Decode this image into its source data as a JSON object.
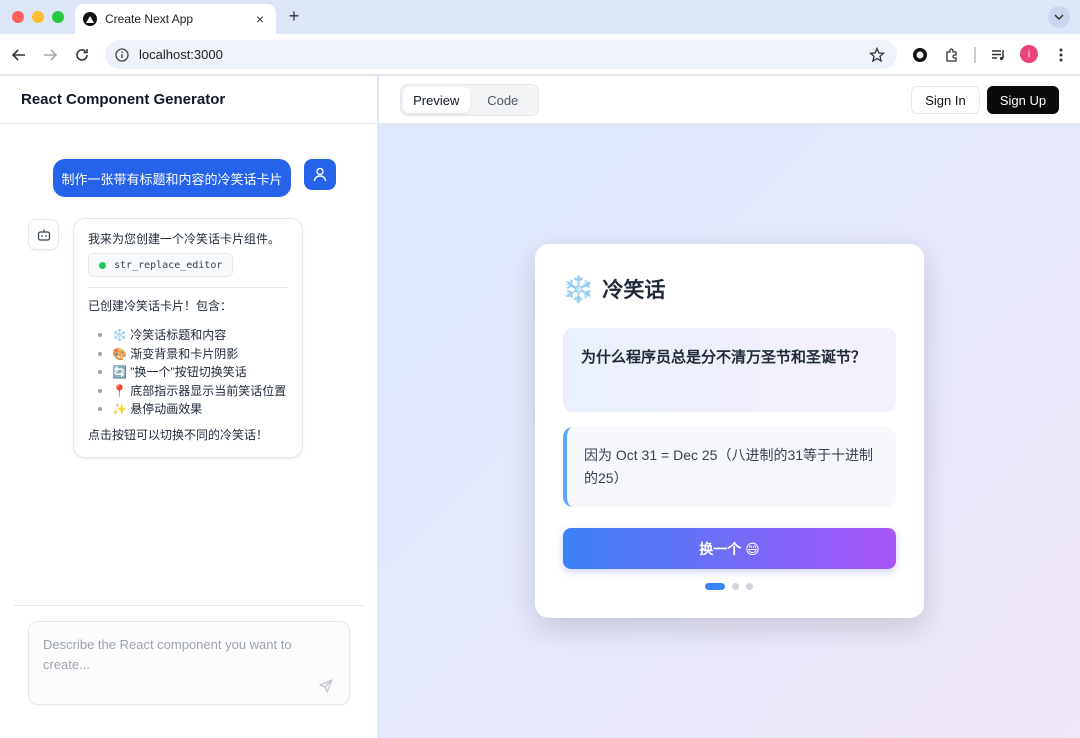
{
  "browser": {
    "tab_title": "Create Next App",
    "url": "localhost:3000",
    "profile_initial": "i"
  },
  "sidebar": {
    "app_title": "React Component Generator",
    "user_message": "制作一张带有标题和内容的冷笑话卡片",
    "bot_message": {
      "intro": "我来为您创建一个冷笑话卡片组件。",
      "tool_name": "str_replace_editor",
      "summary": "已创建冷笑话卡片！包含：",
      "features": [
        "❄️ 冷笑话标题和内容",
        "🎨 渐变背景和卡片阴影",
        "🔄 \"换一个\"按钮切换笑话",
        "📍 底部指示器显示当前笑话位置",
        "✨ 悬停动画效果"
      ],
      "outro": "点击按钮可以切换不同的冷笑话！"
    },
    "input_placeholder": "Describe the React component you want to create..."
  },
  "header": {
    "tabs": [
      {
        "label": "Preview",
        "active": true
      },
      {
        "label": "Code",
        "active": false
      }
    ],
    "sign_in_label": "Sign In",
    "sign_up_label": "Sign Up"
  },
  "card": {
    "icon": "❄️",
    "title": "冷笑话",
    "question": "为什么程序员总是分不清万圣节和圣诞节？",
    "answer": "因为 Oct 31 = Dec 25（八进制的31等于十进制的25）",
    "button_label": "换一个 😄",
    "indicator": {
      "total": 3,
      "current": 1
    }
  },
  "colors": {
    "accent_blue": "#2563eb",
    "gradient_start": "#3b82f6",
    "gradient_end": "#a855f7",
    "dark_button": "#0a0a0a"
  }
}
